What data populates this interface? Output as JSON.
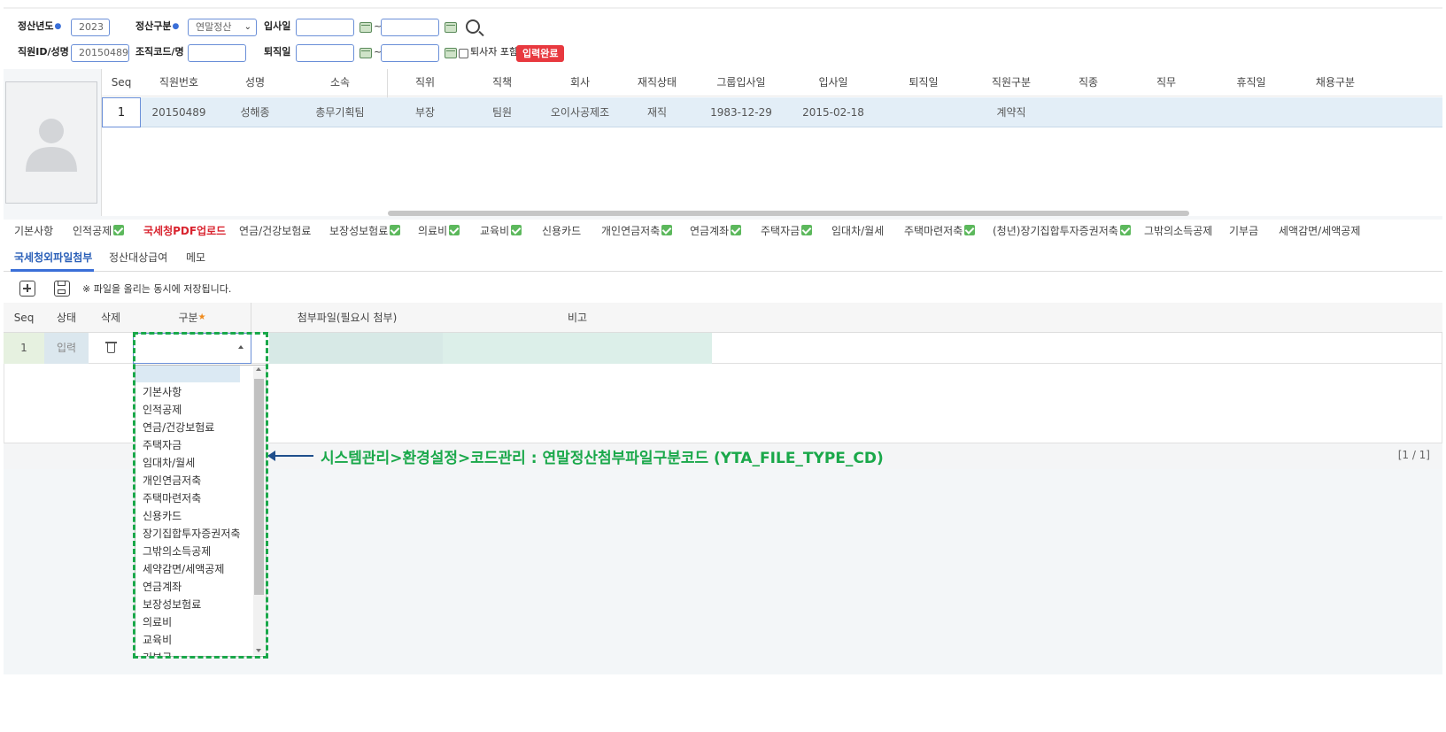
{
  "search": {
    "year_label": "정산년도",
    "year_value": "2023",
    "type_label": "정산구분",
    "type_value": "연말정산",
    "hire_label": "입사일",
    "emp_label": "직원ID/성명",
    "emp_value": "20150489",
    "org_label": "조직코드/명",
    "retire_label": "퇴직일",
    "retired_incl_label": "퇴사자 포함",
    "status_badge": "입력완료",
    "tilde": "~"
  },
  "employee_grid": {
    "columns": [
      "Seq",
      "직원번호",
      "성명",
      "소속",
      "직위",
      "직책",
      "회사",
      "재직상태",
      "그룹입사일",
      "입사일",
      "퇴직일",
      "직원구분",
      "직종",
      "직무",
      "휴직일",
      "채용구분"
    ],
    "rows": [
      {
        "seq": "1",
        "emp_no": "20150489",
        "name": "성해종",
        "dept": "총무기획팀",
        "position": "부장",
        "duty": "팀원",
        "company": "오이사공제조",
        "status": "재직",
        "group_join": "1983-12-29",
        "join": "2015-02-18",
        "retire": "",
        "emp_type": "계약직"
      }
    ]
  },
  "tabs_row1": [
    {
      "label": "기본사항",
      "checked": false,
      "style": "normal"
    },
    {
      "label": "인적공제",
      "checked": true,
      "style": "normal"
    },
    {
      "label": "국세청PDF업로드",
      "checked": false,
      "style": "red"
    },
    {
      "label": "연금/건강보험료",
      "checked": false,
      "style": "normal"
    },
    {
      "label": "보장성보험료",
      "checked": true,
      "style": "normal"
    },
    {
      "label": "의료비",
      "checked": true,
      "style": "normal"
    },
    {
      "label": "교육비",
      "checked": true,
      "style": "normal"
    },
    {
      "label": "신용카드",
      "checked": false,
      "style": "normal"
    },
    {
      "label": "개인연금저축",
      "checked": true,
      "style": "normal"
    },
    {
      "label": "연금계좌",
      "checked": true,
      "style": "normal"
    },
    {
      "label": "주택자금",
      "checked": true,
      "style": "normal"
    },
    {
      "label": "임대차/월세",
      "checked": false,
      "style": "normal"
    },
    {
      "label": "주택마련저축",
      "checked": true,
      "style": "normal"
    },
    {
      "label": "(청년)장기집합투자증권저축",
      "checked": true,
      "style": "normal"
    },
    {
      "label": "그밖의소득공제",
      "checked": false,
      "style": "normal"
    },
    {
      "label": "기부금",
      "checked": false,
      "style": "normal"
    },
    {
      "label": "세액감면/세액공제",
      "checked": false,
      "style": "normal"
    }
  ],
  "tabs_row2": [
    {
      "label": "국세청외파일첨부",
      "active": true
    },
    {
      "label": "정산대상급여",
      "active": false
    },
    {
      "label": "메모",
      "active": false
    }
  ],
  "toolbar": {
    "note": "※ 파일을 올리는 동시에 저장됩니다."
  },
  "file_grid": {
    "columns": [
      "Seq",
      "상태",
      "삭제",
      "구분",
      "첨부파일(필요시 첨부)",
      "비고"
    ],
    "row": {
      "seq": "1",
      "status": "입력"
    },
    "pager": "[1 / 1]"
  },
  "dropdown": {
    "items": [
      "기본사항",
      "인적공제",
      "연금/건강보험료",
      "주택자금",
      "임대차/월세",
      "개인연금저축",
      "주택마련저축",
      "신용카드",
      "장기집합투자증권저축",
      "그밖의소득공제",
      "세약감면/세액공제",
      "연금계좌",
      "보장성보험료",
      "의료비",
      "교육비",
      "기부금"
    ]
  },
  "annotation": "시스템관리>환경설정>코드관리 : 연말정산첨부파일구분코드 (YTA_FILE_TYPE_CD)",
  "colors": {
    "accent": "#3a6fd8",
    "badge": "#e8393f",
    "annotation": "#1aa84a",
    "check": "#5cb85c"
  }
}
